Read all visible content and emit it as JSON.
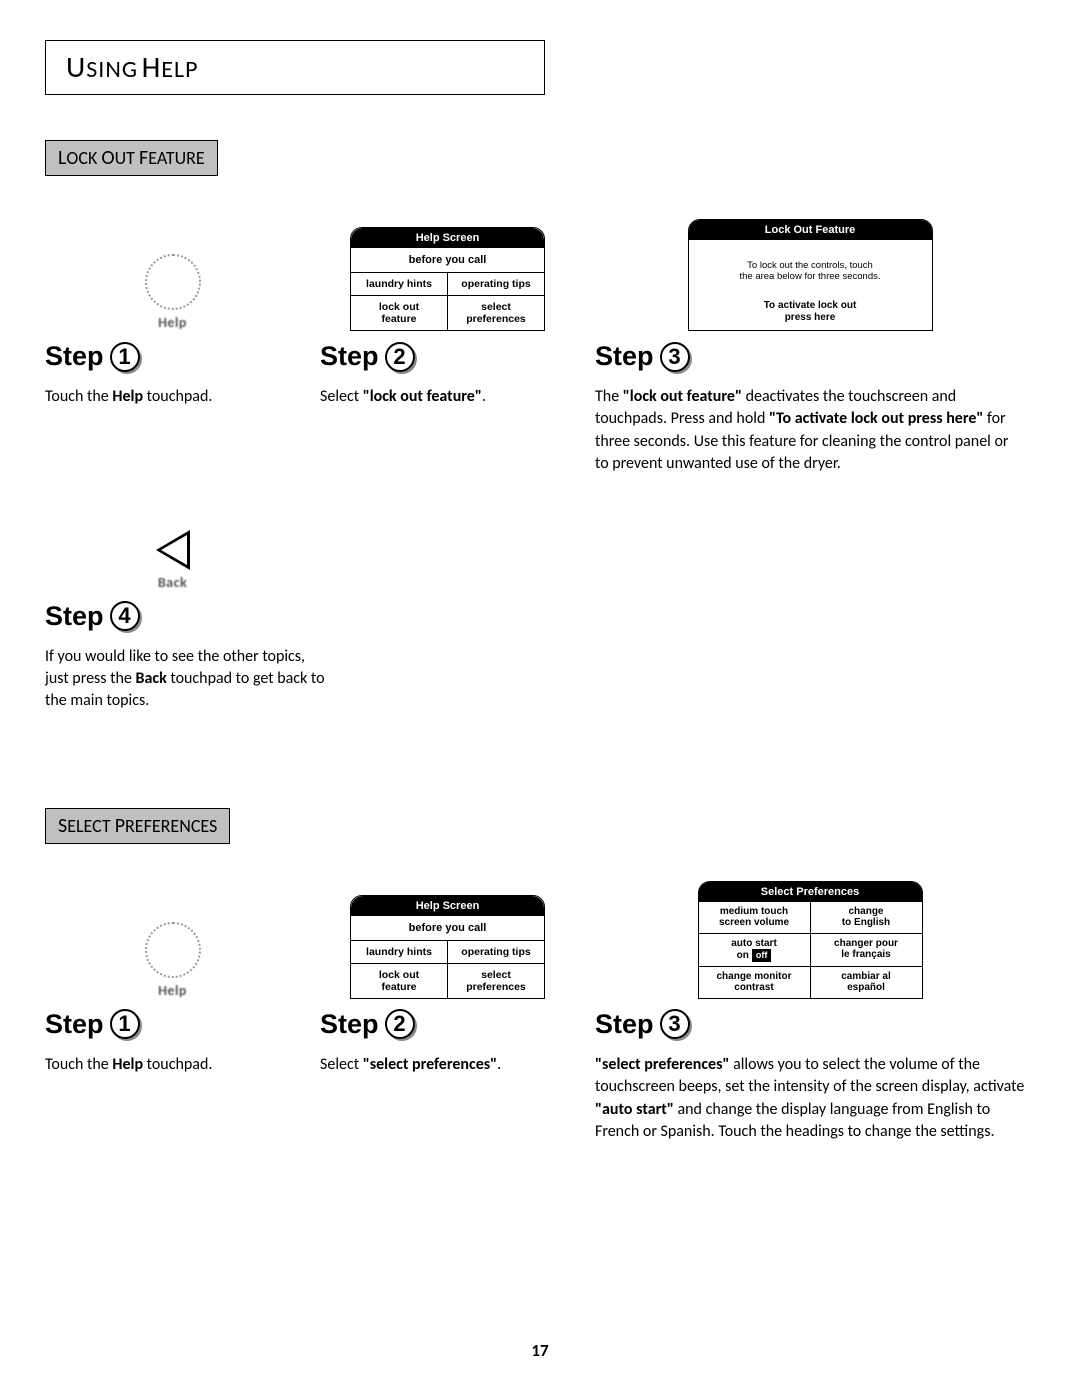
{
  "page_title": {
    "us": "U",
    "sing": "SING",
    "space": " ",
    "h": "H",
    "elp": "ELP"
  },
  "section1": {
    "label": {
      "l": "L",
      "ock": "OCK",
      "o": "O",
      "ut": "UT",
      "f": "F",
      "eature": "EATURE"
    },
    "help_icon_label": "Help",
    "back_icon_label": "Back",
    "help_screen": {
      "header": "Help Screen",
      "before": "before you call",
      "r1c1": "laundry hints",
      "r1c2": "operating tips",
      "r2c1": "lock out\nfeature",
      "r2c2": "select\npreferences"
    },
    "lockout_screen": {
      "header": "Lock Out Feature",
      "instr1": "To lock out the controls, touch",
      "instr2": "the area below for three seconds.",
      "act1": "To activate lock out",
      "act2": "press here"
    },
    "step1": {
      "label": "Step",
      "num": "1",
      "t1": "Touch the ",
      "b1": "Help",
      "t2": " touchpad."
    },
    "step2": {
      "label": "Step",
      "num": "2",
      "t1": "Select ",
      "b1": "\"lock out feature\"",
      "t2": "."
    },
    "step3": {
      "label": "Step",
      "num": "3",
      "t1": "The ",
      "b1": "\"lock out feature\"",
      "t2": " deactivates the touchscreen and touchpads.  Press and hold ",
      "b2": "\"To activate lock out press here\"",
      "t3": " for three seconds.  Use this feature for cleaning the control panel or to prevent unwanted use of the dryer."
    },
    "step4": {
      "label": "Step",
      "num": "4",
      "t1": "If you would like to see the other topics, just press the ",
      "b1": "Back",
      "t2": " touchpad to get back to the main topics."
    }
  },
  "section2": {
    "label": {
      "s": "S",
      "elect": "ELECT",
      "p": "P",
      "references": "REFERENCES"
    },
    "help_icon_label": "Help",
    "help_screen": {
      "header": "Help Screen",
      "before": "before you call",
      "r1c1": "laundry hints",
      "r1c2": "operating tips",
      "r2c1": "lock out\nfeature",
      "r2c2": "select\npreferences"
    },
    "pref_screen": {
      "header": "Select Preferences",
      "r1c1": "medium touch\nscreen volume",
      "r1c2": "change\nto English",
      "r2c1a": "auto start",
      "r2c1_on": "on",
      "r2c1_off": "off",
      "r2c2": "changer pour\nle français",
      "r3c1": "change monitor\ncontrast",
      "r3c2": "cambiar al\nespañol"
    },
    "step1": {
      "label": "Step",
      "num": "1",
      "t1": "Touch the ",
      "b1": "Help",
      "t2": " touchpad."
    },
    "step2": {
      "label": "Step",
      "num": "2",
      "t1": "Select ",
      "b1": "\"select preferences\"",
      "t2": "."
    },
    "step3": {
      "label": "Step",
      "num": "3",
      "b1": "\"select preferences\"",
      "t1": " allows you to select the volume of the touchscreen beeps, set the intensity of the screen display, activate ",
      "b2": "\"auto start\"",
      "t2": " and change the display language from English to French or Spanish. Touch the headings to change the settings."
    }
  },
  "page_number": "17"
}
